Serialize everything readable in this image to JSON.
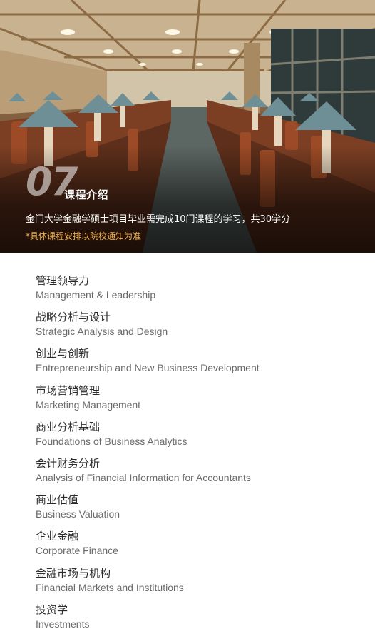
{
  "hero": {
    "number": "07",
    "title": "课程介绍",
    "description": "金门大学金融学硕士项目毕业需完成10门课程的学习，共30学分",
    "note": "*具体课程安排以院校通知为准"
  },
  "courses": [
    {
      "cn": "管理领导力",
      "en": "Management & Leadership"
    },
    {
      "cn": "战略分析与设计",
      "en": "Strategic Analysis and Design"
    },
    {
      "cn": "创业与创新",
      "en": "Entrepreneurship and New Business Development"
    },
    {
      "cn": "市场营销管理",
      "en": "Marketing Management"
    },
    {
      "cn": "商业分析基础",
      "en": "Foundations of Business Analytics"
    },
    {
      "cn": "会计财务分析",
      "en": "Analysis of Financial Information for Accountants"
    },
    {
      "cn": "商业估值",
      "en": "Business Valuation"
    },
    {
      "cn": "企业金融",
      "en": "Corporate Finance"
    },
    {
      "cn": "金融市场与机构",
      "en": "Financial Markets and Institutions"
    },
    {
      "cn": "投资学",
      "en": "Investments"
    }
  ],
  "colors": {
    "note": "#f0b04a",
    "lamp_shade": "#6f8f96",
    "wood": "#8a4a2a"
  }
}
